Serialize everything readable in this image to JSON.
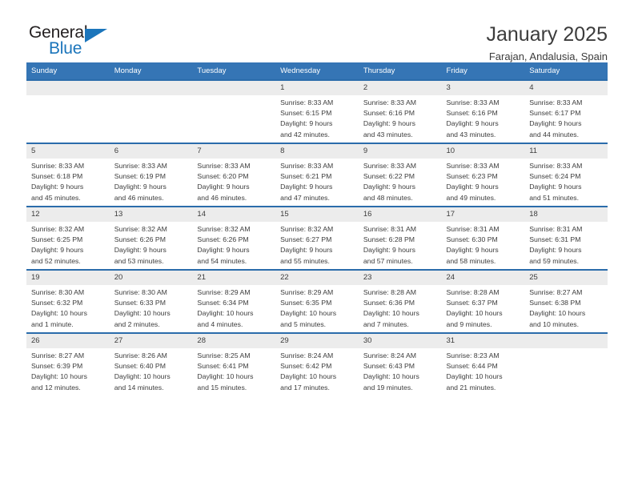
{
  "brand": {
    "name_top": "General",
    "name_bottom": "Blue",
    "triangle_icon": "brand-triangle-icon",
    "accent_color": "#1b75bb"
  },
  "header": {
    "title": "January 2025",
    "subtitle": "Farajan, Andalusia, Spain"
  },
  "calendar": {
    "header_bg": "#3575b5",
    "row_border_color": "#2b6cab",
    "daynum_bg": "#ececec",
    "weekdays": [
      "Sunday",
      "Monday",
      "Tuesday",
      "Wednesday",
      "Thursday",
      "Friday",
      "Saturday"
    ],
    "weeks": [
      [
        {
          "day": "",
          "lines": []
        },
        {
          "day": "",
          "lines": []
        },
        {
          "day": "",
          "lines": []
        },
        {
          "day": "1",
          "lines": [
            "Sunrise: 8:33 AM",
            "Sunset: 6:15 PM",
            "Daylight: 9 hours",
            "and 42 minutes."
          ]
        },
        {
          "day": "2",
          "lines": [
            "Sunrise: 8:33 AM",
            "Sunset: 6:16 PM",
            "Daylight: 9 hours",
            "and 43 minutes."
          ]
        },
        {
          "day": "3",
          "lines": [
            "Sunrise: 8:33 AM",
            "Sunset: 6:16 PM",
            "Daylight: 9 hours",
            "and 43 minutes."
          ]
        },
        {
          "day": "4",
          "lines": [
            "Sunrise: 8:33 AM",
            "Sunset: 6:17 PM",
            "Daylight: 9 hours",
            "and 44 minutes."
          ]
        }
      ],
      [
        {
          "day": "5",
          "lines": [
            "Sunrise: 8:33 AM",
            "Sunset: 6:18 PM",
            "Daylight: 9 hours",
            "and 45 minutes."
          ]
        },
        {
          "day": "6",
          "lines": [
            "Sunrise: 8:33 AM",
            "Sunset: 6:19 PM",
            "Daylight: 9 hours",
            "and 46 minutes."
          ]
        },
        {
          "day": "7",
          "lines": [
            "Sunrise: 8:33 AM",
            "Sunset: 6:20 PM",
            "Daylight: 9 hours",
            "and 46 minutes."
          ]
        },
        {
          "day": "8",
          "lines": [
            "Sunrise: 8:33 AM",
            "Sunset: 6:21 PM",
            "Daylight: 9 hours",
            "and 47 minutes."
          ]
        },
        {
          "day": "9",
          "lines": [
            "Sunrise: 8:33 AM",
            "Sunset: 6:22 PM",
            "Daylight: 9 hours",
            "and 48 minutes."
          ]
        },
        {
          "day": "10",
          "lines": [
            "Sunrise: 8:33 AM",
            "Sunset: 6:23 PM",
            "Daylight: 9 hours",
            "and 49 minutes."
          ]
        },
        {
          "day": "11",
          "lines": [
            "Sunrise: 8:33 AM",
            "Sunset: 6:24 PM",
            "Daylight: 9 hours",
            "and 51 minutes."
          ]
        }
      ],
      [
        {
          "day": "12",
          "lines": [
            "Sunrise: 8:32 AM",
            "Sunset: 6:25 PM",
            "Daylight: 9 hours",
            "and 52 minutes."
          ]
        },
        {
          "day": "13",
          "lines": [
            "Sunrise: 8:32 AM",
            "Sunset: 6:26 PM",
            "Daylight: 9 hours",
            "and 53 minutes."
          ]
        },
        {
          "day": "14",
          "lines": [
            "Sunrise: 8:32 AM",
            "Sunset: 6:26 PM",
            "Daylight: 9 hours",
            "and 54 minutes."
          ]
        },
        {
          "day": "15",
          "lines": [
            "Sunrise: 8:32 AM",
            "Sunset: 6:27 PM",
            "Daylight: 9 hours",
            "and 55 minutes."
          ]
        },
        {
          "day": "16",
          "lines": [
            "Sunrise: 8:31 AM",
            "Sunset: 6:28 PM",
            "Daylight: 9 hours",
            "and 57 minutes."
          ]
        },
        {
          "day": "17",
          "lines": [
            "Sunrise: 8:31 AM",
            "Sunset: 6:30 PM",
            "Daylight: 9 hours",
            "and 58 minutes."
          ]
        },
        {
          "day": "18",
          "lines": [
            "Sunrise: 8:31 AM",
            "Sunset: 6:31 PM",
            "Daylight: 9 hours",
            "and 59 minutes."
          ]
        }
      ],
      [
        {
          "day": "19",
          "lines": [
            "Sunrise: 8:30 AM",
            "Sunset: 6:32 PM",
            "Daylight: 10 hours",
            "and 1 minute."
          ]
        },
        {
          "day": "20",
          "lines": [
            "Sunrise: 8:30 AM",
            "Sunset: 6:33 PM",
            "Daylight: 10 hours",
            "and 2 minutes."
          ]
        },
        {
          "day": "21",
          "lines": [
            "Sunrise: 8:29 AM",
            "Sunset: 6:34 PM",
            "Daylight: 10 hours",
            "and 4 minutes."
          ]
        },
        {
          "day": "22",
          "lines": [
            "Sunrise: 8:29 AM",
            "Sunset: 6:35 PM",
            "Daylight: 10 hours",
            "and 5 minutes."
          ]
        },
        {
          "day": "23",
          "lines": [
            "Sunrise: 8:28 AM",
            "Sunset: 6:36 PM",
            "Daylight: 10 hours",
            "and 7 minutes."
          ]
        },
        {
          "day": "24",
          "lines": [
            "Sunrise: 8:28 AM",
            "Sunset: 6:37 PM",
            "Daylight: 10 hours",
            "and 9 minutes."
          ]
        },
        {
          "day": "25",
          "lines": [
            "Sunrise: 8:27 AM",
            "Sunset: 6:38 PM",
            "Daylight: 10 hours",
            "and 10 minutes."
          ]
        }
      ],
      [
        {
          "day": "26",
          "lines": [
            "Sunrise: 8:27 AM",
            "Sunset: 6:39 PM",
            "Daylight: 10 hours",
            "and 12 minutes."
          ]
        },
        {
          "day": "27",
          "lines": [
            "Sunrise: 8:26 AM",
            "Sunset: 6:40 PM",
            "Daylight: 10 hours",
            "and 14 minutes."
          ]
        },
        {
          "day": "28",
          "lines": [
            "Sunrise: 8:25 AM",
            "Sunset: 6:41 PM",
            "Daylight: 10 hours",
            "and 15 minutes."
          ]
        },
        {
          "day": "29",
          "lines": [
            "Sunrise: 8:24 AM",
            "Sunset: 6:42 PM",
            "Daylight: 10 hours",
            "and 17 minutes."
          ]
        },
        {
          "day": "30",
          "lines": [
            "Sunrise: 8:24 AM",
            "Sunset: 6:43 PM",
            "Daylight: 10 hours",
            "and 19 minutes."
          ]
        },
        {
          "day": "31",
          "lines": [
            "Sunrise: 8:23 AM",
            "Sunset: 6:44 PM",
            "Daylight: 10 hours",
            "and 21 minutes."
          ]
        },
        {
          "day": "",
          "lines": []
        }
      ]
    ]
  }
}
